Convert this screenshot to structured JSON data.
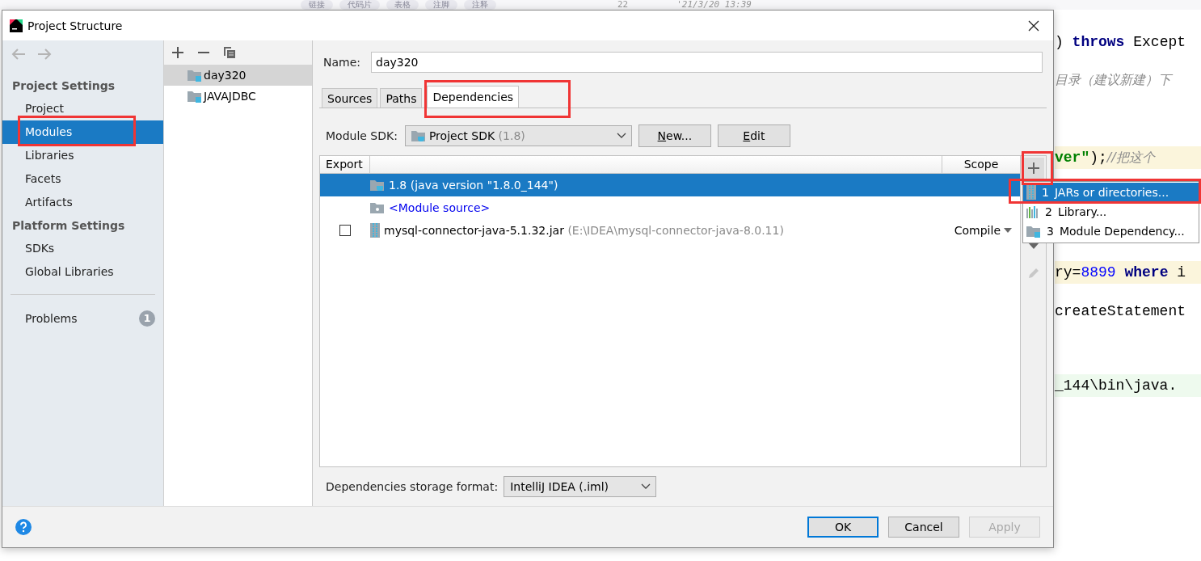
{
  "background": {
    "toolbar_chips": [
      "链接",
      "代码片",
      "表格",
      "注脚",
      "注释"
    ],
    "line_number": "22",
    "timestamp": "'21/3/20 13:39",
    "code_lines": [
      {
        "kind": "plain",
        "tokens": [
          {
            "kind": "plain",
            "text": ")"
          },
          {
            "kind": "keyword",
            "text": " throws"
          },
          {
            "kind": "plain",
            "text": " Except"
          }
        ]
      },
      {
        "kind": "plain",
        "tokens": [
          {
            "kind": "comment",
            "text": "目录（建议新建）下"
          }
        ]
      },
      {
        "kind": "highlight",
        "tokens": [
          {
            "kind": "string",
            "text": "ver\""
          },
          {
            "kind": "plain",
            "text": ");"
          },
          {
            "kind": "comment",
            "text": "//把这个"
          }
        ]
      },
      {
        "kind": "highlight",
        "tokens": [
          {
            "kind": "plain",
            "text": "ry="
          },
          {
            "kind": "number",
            "text": "8899"
          },
          {
            "kind": "keyword",
            "text": " where"
          },
          {
            "kind": "plain",
            "text": " i"
          }
        ]
      },
      {
        "kind": "plain",
        "tokens": [
          {
            "kind": "plain",
            "text": "createStatement"
          }
        ]
      },
      {
        "kind": "output",
        "tokens": [
          {
            "kind": "plain",
            "text": "_144\\bin\\java."
          }
        ]
      }
    ]
  },
  "dialog": {
    "title": "Project Structure",
    "sidebar": {
      "sections": [
        {
          "heading": "Project Settings",
          "items": [
            {
              "label": "Project",
              "selected": false
            },
            {
              "label": "Modules",
              "selected": true
            },
            {
              "label": "Libraries",
              "selected": false
            },
            {
              "label": "Facets",
              "selected": false
            },
            {
              "label": "Artifacts",
              "selected": false
            }
          ]
        },
        {
          "heading": "Platform Settings",
          "items": [
            {
              "label": "SDKs",
              "selected": false
            },
            {
              "label": "Global Libraries",
              "selected": false
            }
          ]
        }
      ],
      "problems": {
        "label": "Problems",
        "count": "1"
      }
    },
    "modules": [
      {
        "name": "day320",
        "selected": true
      },
      {
        "name": "JAVAJDBC",
        "selected": false
      }
    ],
    "name_field": {
      "label": "Name:",
      "value": "day320"
    },
    "tabs": [
      {
        "label": "Sources",
        "selected": false
      },
      {
        "label": "Paths",
        "selected": false
      },
      {
        "label": "Dependencies",
        "selected": true
      }
    ],
    "module_sdk": {
      "label": "Module SDK:",
      "value": "Project SDK",
      "version": "(1.8)"
    },
    "sdk_buttons": [
      "New...",
      "Edit"
    ],
    "table": {
      "columns": [
        "Export",
        "Scope"
      ],
      "rows": [
        {
          "kind": "sdk",
          "name": "1.8 (java version \"1.8.0_144\")",
          "selected": true
        },
        {
          "kind": "source",
          "name": "<Module source>",
          "selected": false
        },
        {
          "kind": "jar",
          "name": "mysql-connector-java-5.1.32.jar",
          "path": "(E:\\IDEA\\mysql-connector-java-8.0.11)",
          "checked": false,
          "scope": "Compile",
          "selected": false
        }
      ]
    },
    "storage_format": {
      "label": "Dependencies storage format:",
      "value": "IntelliJ IDEA (.iml)"
    },
    "buttons": [
      {
        "label": "OK",
        "kind": "default",
        "disabled": false
      },
      {
        "label": "Cancel",
        "kind": "normal",
        "disabled": false
      },
      {
        "label": "Apply",
        "kind": "normal",
        "disabled": true
      }
    ]
  },
  "popup_menu": [
    {
      "number": "1",
      "label": "JARs or directories...",
      "kind": "jar",
      "selected": true
    },
    {
      "number": "2",
      "label": "Library...",
      "kind": "library",
      "selected": false
    },
    {
      "number": "3",
      "label": "Module Dependency...",
      "kind": "module",
      "selected": false
    }
  ]
}
